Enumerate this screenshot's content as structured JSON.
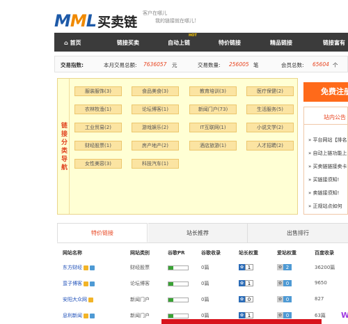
{
  "brand": {
    "logo_text": "MML",
    "name": "买卖链",
    "slogan_line1": "客户在哪儿",
    "slogan_line2": "我的链接就在哪儿!"
  },
  "nav": {
    "home": "首页",
    "items": [
      "链接买卖",
      "自动上链",
      "特价链接",
      "精品链接",
      "链接富有"
    ],
    "hot_badge": "HOT"
  },
  "stats": {
    "label": "交易指数:",
    "month_total_label": "本月交易总额:",
    "month_total": "7636057",
    "month_total_unit": "元",
    "volume_label": "交易数量:",
    "volume": "256005",
    "volume_unit": "笔",
    "members_label": "会员总数:",
    "members": "65604",
    "members_unit": "个"
  },
  "categories": {
    "side_label": "链接分类导航",
    "items": [
      "服装服饰(3)",
      "食品美食(3)",
      "教育培训(3)",
      "医疗保健(2)",
      "农林牧渔(1)",
      "论坛博客(1)",
      "新闻门户(73)",
      "生活服务(5)",
      "工业贸易(2)",
      "游戏娱乐(2)",
      "IT互联网(1)",
      "小说文学(2)",
      "财经股票(1)",
      "房产地产(2)",
      "酒店旅游(1)",
      "人才招聘(2)",
      "女性美容(3)",
      "科技汽车(1)"
    ]
  },
  "register": {
    "label": "免费注册"
  },
  "notice": {
    "title": "站内公告",
    "items": [
      "» 平台网站【排名",
      "» 自动上链功能上",
      "» 买卖链链接卖卡",
      "» 买链接须知!",
      "» 卖链接须知!",
      "» 正规站点如何"
    ]
  },
  "tabs": [
    "特价链接",
    "站长推荐",
    "出售排行"
  ],
  "table": {
    "headers": [
      "网站名称",
      "网站类别",
      "谷歌PR",
      "谷歌收录",
      "站长权重",
      "爱站权重",
      "百度收录"
    ],
    "rows": [
      {
        "name": "东方财经",
        "category": "财经股票",
        "pr": "0",
        "google": "0篇",
        "zz": "1",
        "aiz": "2",
        "baidu": "36200篇"
      },
      {
        "name": "蛮子博客",
        "category": "论坛博客",
        "pr": "0",
        "google": "0篇",
        "zz": "1",
        "aiz": "0",
        "baidu": "9650"
      },
      {
        "name": "安阳大众网",
        "category": "新闻门户",
        "pr": "0",
        "google": "0篇",
        "zz": "0",
        "aiz": "0",
        "baidu": "827"
      },
      {
        "name": "息利新闻",
        "category": "新闻门户",
        "pr": "0",
        "google": "0篇",
        "zz": "1",
        "aiz": "0",
        "baidu": "63篇"
      }
    ]
  },
  "colors": {
    "accent": "#e8441f",
    "brand_blue": "#1e5aa8",
    "nav_bg": "#3b3b3b",
    "category_bg": "#ffffd4",
    "register_bg": "#ff6a1a"
  }
}
